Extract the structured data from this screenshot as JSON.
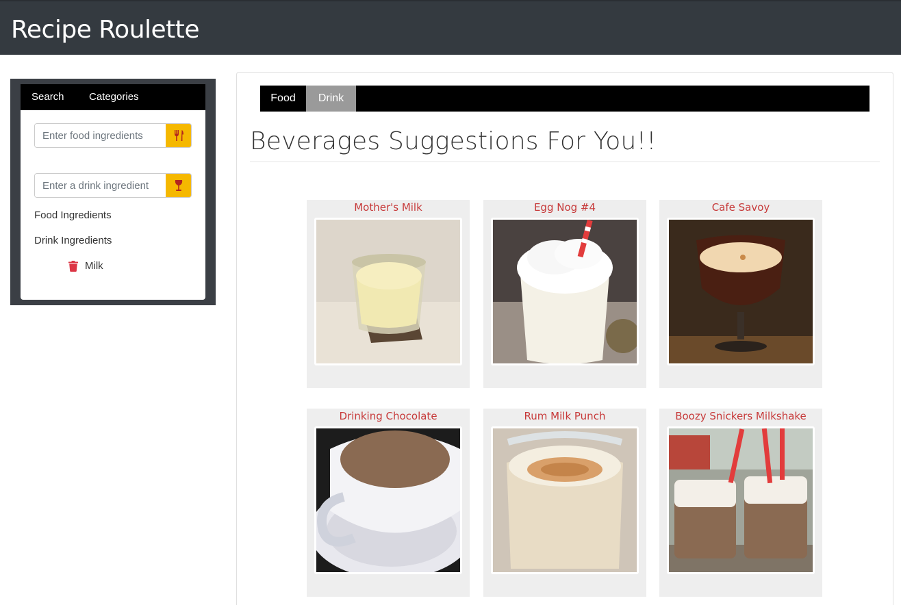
{
  "header": {
    "title": "Recipe Roulette"
  },
  "sidebar": {
    "tabs": [
      "Search",
      "Categories"
    ],
    "food_input": {
      "placeholder": "Enter food ingredients"
    },
    "drink_input": {
      "placeholder": "Enter a drink ingredient"
    },
    "food_label": "Food Ingredients",
    "drink_label": "Drink Ingredients",
    "drink_ingredients": [
      "Milk"
    ],
    "food_button_icon": "utensils-icon",
    "drink_button_icon": "wine-glass-icon",
    "remove_icon": "trash-icon"
  },
  "main": {
    "tabs": [
      {
        "label": "Food",
        "active": false
      },
      {
        "label": "Drink",
        "active": true
      }
    ],
    "heading": "Beverages Suggestions For You!!",
    "cards": [
      {
        "title": "Mother's Milk"
      },
      {
        "title": "Egg Nog #4"
      },
      {
        "title": "Cafe Savoy"
      },
      {
        "title": "Drinking Chocolate"
      },
      {
        "title": "Rum Milk Punch"
      },
      {
        "title": "Boozy Snickers Milkshake"
      }
    ]
  },
  "colors": {
    "navbar": "#343a40",
    "accent_button": "#f5b800",
    "card_title": "#c73a3a",
    "active_tab": "#9a9a9a"
  }
}
